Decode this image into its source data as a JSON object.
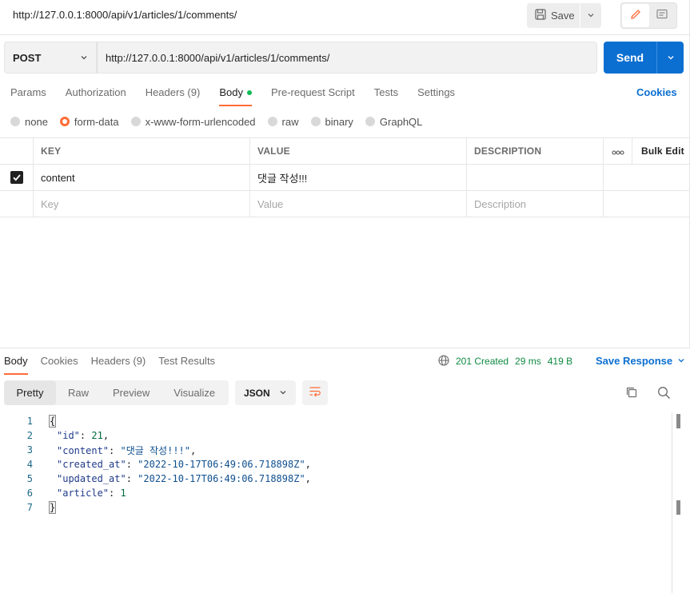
{
  "header": {
    "title_url": "http://127.0.0.1:8000/api/v1/articles/1/comments/",
    "save_label": "Save"
  },
  "request": {
    "method": "POST",
    "url": "http://127.0.0.1:8000/api/v1/articles/1/comments/",
    "send_label": "Send",
    "tabs": [
      {
        "label": "Params"
      },
      {
        "label": "Authorization"
      },
      {
        "label": "Headers (9)"
      },
      {
        "label": "Body"
      },
      {
        "label": "Pre-request Script"
      },
      {
        "label": "Tests"
      },
      {
        "label": "Settings"
      }
    ],
    "cookies_label": "Cookies",
    "body_types": [
      {
        "label": "none"
      },
      {
        "label": "form-data"
      },
      {
        "label": "x-www-form-urlencoded"
      },
      {
        "label": "raw"
      },
      {
        "label": "binary"
      },
      {
        "label": "GraphQL"
      }
    ],
    "table": {
      "headers": {
        "key": "KEY",
        "value": "VALUE",
        "description": "DESCRIPTION",
        "more": "ooo",
        "bulk_edit": "Bulk Edit"
      },
      "rows": [
        {
          "key": "content",
          "value": "댓글 작성!!!",
          "description": ""
        }
      ],
      "placeholders": {
        "key": "Key",
        "value": "Value",
        "description": "Description"
      }
    }
  },
  "response": {
    "tabs": [
      {
        "label": "Body"
      },
      {
        "label": "Cookies"
      },
      {
        "label": "Headers (9)"
      },
      {
        "label": "Test Results"
      }
    ],
    "status": "201 Created",
    "time": "29 ms",
    "size": "419 B",
    "save_response_label": "Save Response",
    "view_tabs": [
      {
        "label": "Pretty"
      },
      {
        "label": "Raw"
      },
      {
        "label": "Preview"
      },
      {
        "label": "Visualize"
      }
    ],
    "format": "JSON",
    "code": {
      "line_numbers": [
        "1",
        "2",
        "3",
        "4",
        "5",
        "6",
        "7"
      ],
      "open": "{",
      "close": "}",
      "fields": [
        {
          "key": "\"id\"",
          "sep": ": ",
          "value": "21",
          "trail": ","
        },
        {
          "key": "\"content\"",
          "sep": ": ",
          "value": "\"댓글 작성!!!\"",
          "trail": ","
        },
        {
          "key": "\"created_at\"",
          "sep": ": ",
          "value": "\"2022-10-17T06:49:06.718898Z\"",
          "trail": ","
        },
        {
          "key": "\"updated_at\"",
          "sep": ": ",
          "value": "\"2022-10-17T06:49:06.718898Z\"",
          "trail": ","
        },
        {
          "key": "\"article\"",
          "sep": ": ",
          "value": "1",
          "trail": ""
        }
      ]
    }
  },
  "colors": {
    "accent": "#ff6c37",
    "primary": "#0b6fd1",
    "success": "#0cbb52"
  }
}
